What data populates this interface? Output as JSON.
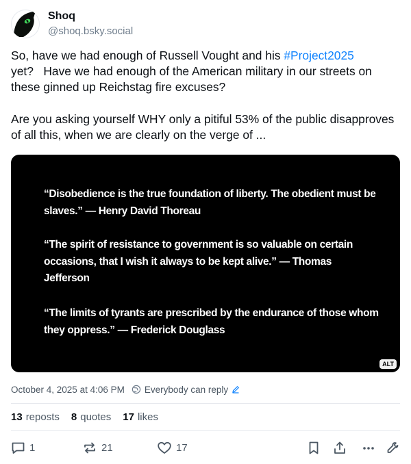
{
  "author": {
    "display_name": "Shoq",
    "handle": "@shoq.bsky.social",
    "avatar_icon": "black-cat-face-with-green-eye"
  },
  "post": {
    "text_before_tag": "So, have we had enough of Russell Vought and his ",
    "hashtag": "#Project2025",
    "text_after_tag": "\nyet?   Have we had enough of the American military in our streets on these ginned up Reichstag fire excuses?\n\nAre you asking yourself WHY only a pitiful 53% of the public disapproves of all this, when we are clearly on the verge of ..."
  },
  "image": {
    "quote1": "“Disobedience is the true foundation of liberty. The obedient must be slaves.” — Henry David Thoreau",
    "quote2": "“The spirit of resistance to government is so valuable on certain occasions, that I wish it always to be kept alive.” — Thomas Jefferson",
    "quote3": "“The limits of tyrants are prescribed by the endurance of those whom they oppress.” — Frederick Douglass",
    "alt_badge": "ALT"
  },
  "meta": {
    "timestamp": "October 4, 2025 at 4:06 PM",
    "reply_setting": "Everybody can reply"
  },
  "stats": {
    "reposts_count": "13",
    "reposts_label": "reposts",
    "quotes_count": "8",
    "quotes_label": "quotes",
    "likes_count": "17",
    "likes_label": "likes"
  },
  "actions": {
    "reply_count": "1",
    "repost_count": "21",
    "like_count": "17"
  },
  "colors": {
    "link": "#1083fe",
    "muted_text": "#4b5763",
    "image_background": "#000000"
  }
}
